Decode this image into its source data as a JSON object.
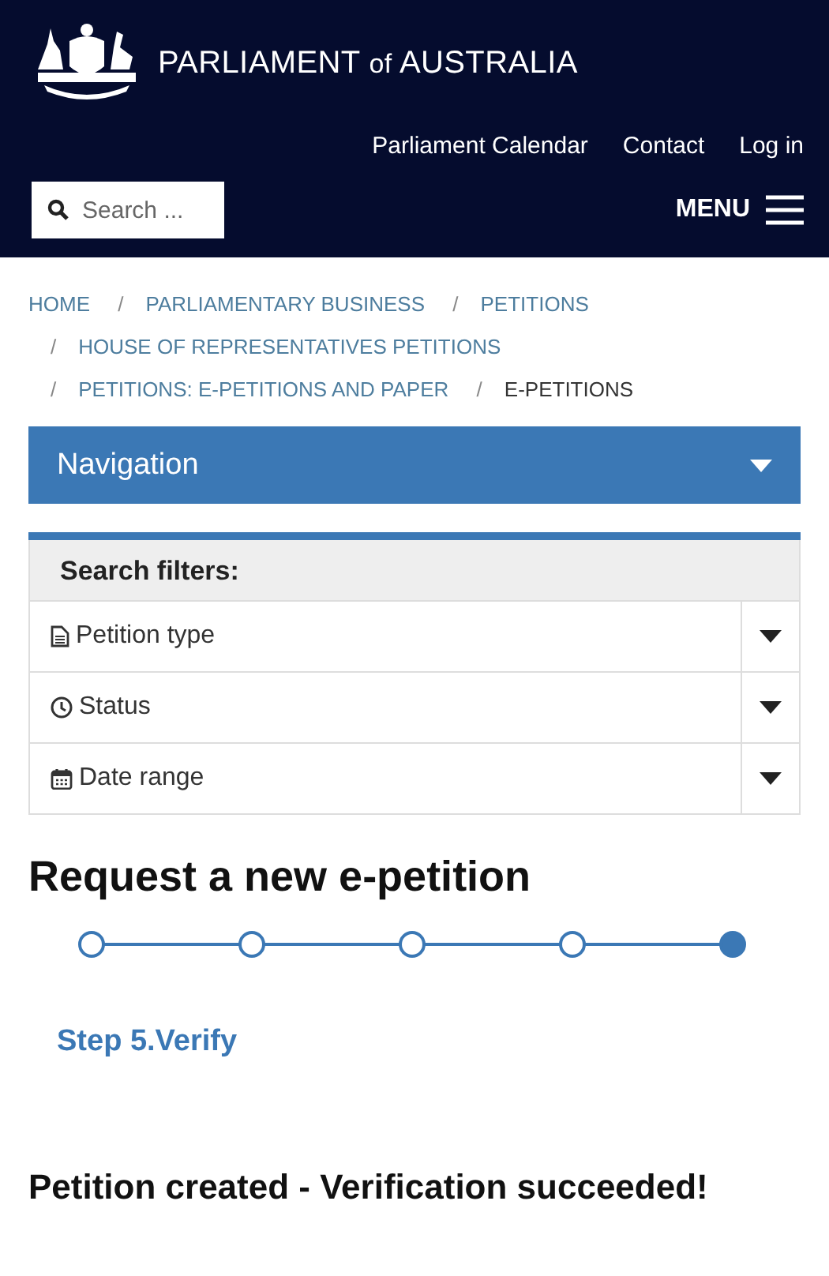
{
  "header": {
    "site_title_main": "PARLIAMENT",
    "site_title_of": "of",
    "site_title_end": "AUSTRALIA",
    "links": [
      "Parliament Calendar",
      "Contact",
      "Log in"
    ],
    "search": {
      "placeholder": "Search ..."
    },
    "menu": {
      "label": "MENU"
    }
  },
  "breadcrumbs": [
    {
      "label": "HOME",
      "current": false
    },
    {
      "label": "PARLIAMENTARY BUSINESS",
      "separator": "/",
      "current": false
    },
    {
      "label": "PETITIONS",
      "separator": "/",
      "current": false
    },
    {
      "label": "HOUSE OF REPRESENTATIVES PETITIONS",
      "separator": "/",
      "current": false
    },
    {
      "label": "PETITIONS: E-PETITIONS AND PAPER",
      "separator": "/",
      "current": false
    },
    {
      "label": "E-PETITIONS",
      "separator": "/",
      "current": true
    }
  ],
  "navigation": {
    "label": "Navigation",
    "expanded": false
  },
  "filters": {
    "title": "Search filters:",
    "items": [
      {
        "kind": "document",
        "label": "Petition type"
      },
      {
        "kind": "clock",
        "label": "Status"
      },
      {
        "kind": "calendar",
        "label": "Date range"
      }
    ]
  },
  "heading": "Request a new e-petition",
  "steps": [
    {
      "selected": false
    },
    {
      "selected": false
    },
    {
      "selected": false
    },
    {
      "selected": false
    },
    {
      "selected": true
    }
  ],
  "step_label": "Step 5.Verify",
  "result": "Petition created - Verification succeeded!"
}
